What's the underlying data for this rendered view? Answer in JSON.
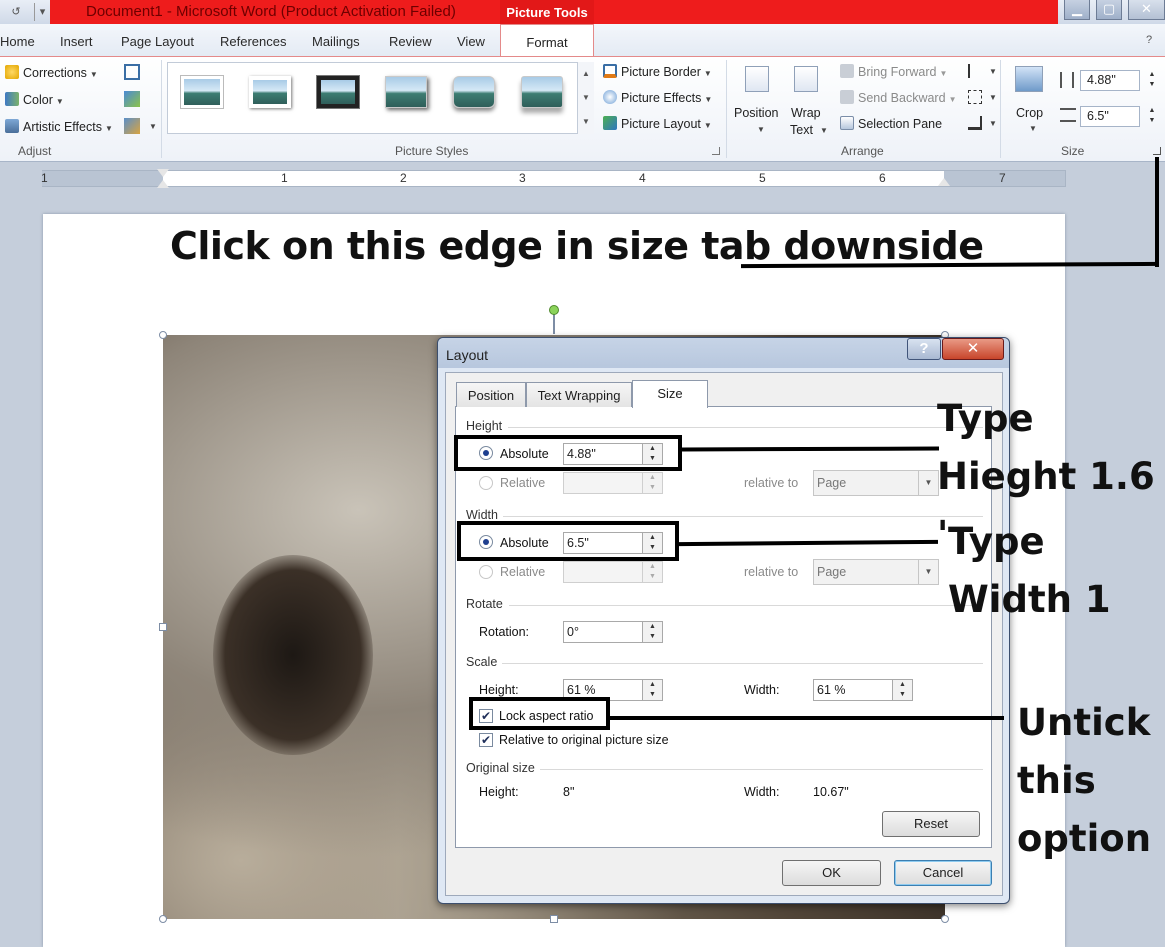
{
  "window": {
    "title": "Document1 - Microsoft Word (Product Activation Failed)",
    "contextual_tab": "Picture Tools",
    "min": "▁",
    "max": "▢",
    "close": "✕"
  },
  "tabs": [
    "Home",
    "Insert",
    "Page Layout",
    "References",
    "Mailings",
    "Review",
    "View",
    "Format"
  ],
  "ribbon": {
    "adjust": {
      "label": "Adjust",
      "corrections": "Corrections",
      "color": "Color",
      "artistic": "Artistic Effects"
    },
    "styles": {
      "label": "Picture Styles",
      "border": "Picture Border",
      "effects": "Picture Effects",
      "layout": "Picture Layout"
    },
    "arrange": {
      "label": "Arrange",
      "position": "Position",
      "wrap1": "Wrap",
      "wrap2": "Text",
      "bring_forward": "Bring Forward",
      "send_backward": "Send Backward",
      "selection_pane": "Selection Pane"
    },
    "size": {
      "label": "Size",
      "crop": "Crop",
      "height": "4.88\"",
      "width": "6.5\""
    }
  },
  "ruler": {
    "numbers": [
      "1",
      "1",
      "2",
      "3",
      "4",
      "5",
      "6",
      "7"
    ]
  },
  "annotations": {
    "top": "Click on this edge in size tab downside",
    "height_note_1": "Type",
    "height_note_2": "Hieght 1.6 '",
    "width_note_1": "Type",
    "width_note_2": "Width 1",
    "lock_note_1": "Untick",
    "lock_note_2": "this",
    "lock_note_3": "option"
  },
  "dialog": {
    "title": "Layout",
    "help": "?",
    "close": "✕",
    "tabs": [
      "Position",
      "Text Wrapping",
      "Size"
    ],
    "height": {
      "section": "Height",
      "absolute": "Absolute",
      "absolute_value": "4.88\"",
      "relative": "Relative",
      "relative_to": "relative to",
      "relative_to_value": "Page"
    },
    "width": {
      "section": "Width",
      "absolute": "Absolute",
      "absolute_value": "6.5\"",
      "relative": "Relative",
      "relative_to": "relative to",
      "relative_to_value": "Page"
    },
    "rotate": {
      "section": "Rotate",
      "label": "Rotation:",
      "value": "0°"
    },
    "scale": {
      "section": "Scale",
      "height_label": "Height:",
      "height_value": "61 %",
      "width_label": "Width:",
      "width_value": "61 %",
      "lock": "Lock aspect ratio",
      "lock_checked": true,
      "relative_original": "Relative to original picture size",
      "relative_checked": true
    },
    "original": {
      "section": "Original size",
      "height_label": "Height:",
      "height_value": "8\"",
      "width_label": "Width:",
      "width_value": "10.67\""
    },
    "reset": "Reset",
    "ok": "OK",
    "cancel": "Cancel"
  }
}
